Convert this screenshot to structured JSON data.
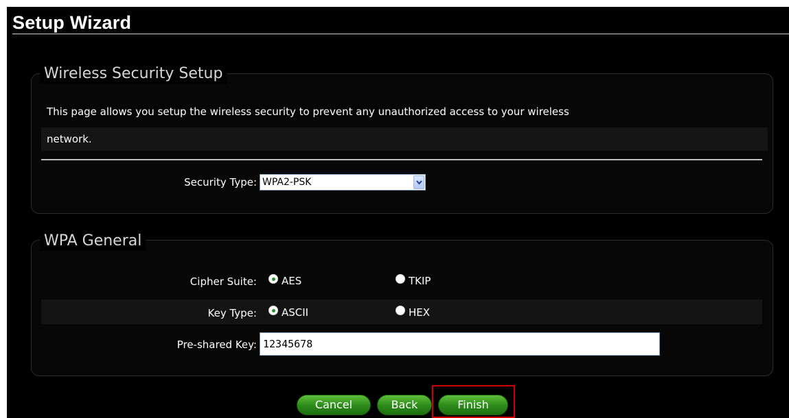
{
  "header": {
    "title": "Setup Wizard"
  },
  "wireless_security": {
    "legend": "Wireless Security Setup",
    "description_line1": "This page allows you setup the wireless security to prevent any unauthorized access to your wireless",
    "description_line2": "network.",
    "security_type_label": "Security Type:",
    "security_type_value": "WPA2-PSK"
  },
  "wpa_general": {
    "legend": "WPA General",
    "cipher_suite_label": "Cipher Suite:",
    "cipher_options": [
      {
        "label": "AES",
        "selected": true
      },
      {
        "label": "TKIP",
        "selected": false
      }
    ],
    "key_type_label": "Key Type:",
    "key_type_options": [
      {
        "label": "ASCII",
        "selected": true
      },
      {
        "label": "HEX",
        "selected": false
      }
    ],
    "psk_label": "Pre-shared Key:",
    "psk_value": "12345678"
  },
  "buttons": {
    "cancel": "Cancel",
    "back": "Back",
    "finish": "Finish"
  },
  "colors": {
    "background": "#000000",
    "button_green": "#2f8e1b",
    "highlight_red": "#d10000"
  }
}
